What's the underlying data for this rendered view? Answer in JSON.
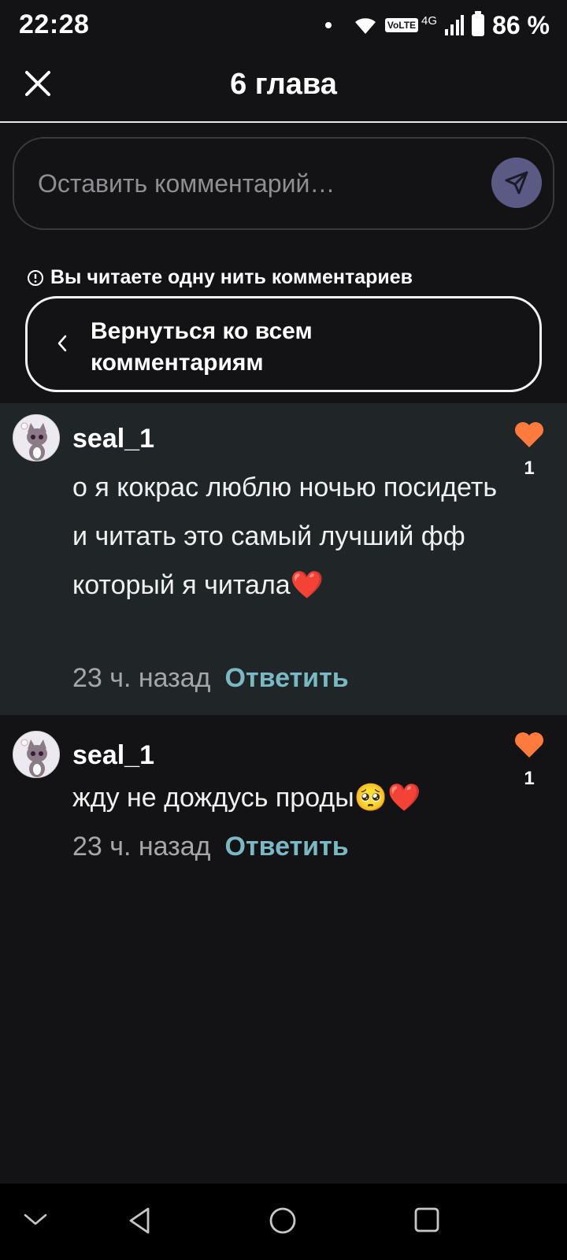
{
  "status_bar": {
    "time": "22:28",
    "volte": "VoLTE",
    "network": "4G",
    "battery": "86 %"
  },
  "header": {
    "title": "6 глава",
    "close_icon": "close-icon"
  },
  "comment_input": {
    "placeholder": "Оставить комментарий…",
    "send_icon": "send-icon"
  },
  "thread": {
    "notice": "Вы читаете одну нить комментариев",
    "back_label": "Вернуться ко всем комментариям"
  },
  "comments": [
    {
      "username": "seal_1",
      "text": "о я кокрас люблю ночью посидеть и читать это самый лучший фф который я читала",
      "emoji": "❤️",
      "time": "23 ч. назад",
      "reply": "Ответить",
      "likes": "1",
      "highlighted": true
    },
    {
      "username": "seal_1",
      "text": "жду не дождусь проды",
      "emoji": "🥺❤️",
      "time": "23 ч. назад",
      "reply": "Ответить",
      "likes": "1",
      "highlighted": false
    }
  ],
  "colors": {
    "background": "#131316",
    "highlight": "#202628",
    "accent_like": "#ff7a3d",
    "reply_link": "#7ab8c4",
    "send_button": "#5b5a85"
  }
}
